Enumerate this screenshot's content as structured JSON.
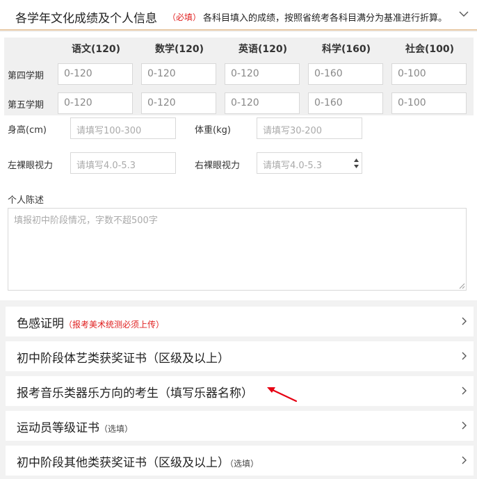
{
  "section": {
    "title": "各学年文化成绩及个人信息",
    "required": "（必填）",
    "note": "各科目填入的成绩，按照省统考各科目满分为基准进行折算。"
  },
  "grades": {
    "subjects": [
      "语文(120)",
      "数学(120)",
      "英语(120)",
      "科学(160)",
      "社会(100)"
    ],
    "terms": [
      {
        "label": "第四学期",
        "placeholders": [
          "0-120",
          "0-120",
          "0-120",
          "0-160",
          "0-100"
        ]
      },
      {
        "label": "第五学期",
        "placeholders": [
          "0-120",
          "0-120",
          "0-120",
          "0-160",
          "0-100"
        ]
      }
    ]
  },
  "personal": {
    "height_label": "身高(cm)",
    "height_placeholder": "请填写100-300",
    "weight_label": "体重(kg)",
    "weight_placeholder": "请填写30-200",
    "left_vision_label": "左裸眼视力",
    "left_vision_placeholder": "请填写4.0-5.3",
    "right_vision_label": "右裸眼视力",
    "right_vision_placeholder": "请填写4.0-5.3",
    "statement_label": "个人陈述",
    "statement_placeholder": "填报初中阶段情况，字数不超500字"
  },
  "rows": [
    {
      "title": "色感证明",
      "note": "（报考美术统测必须上传）",
      "note_color": "red"
    },
    {
      "title": "初中阶段体艺类获奖证书（区级及以上）",
      "note": ""
    },
    {
      "title": "报考音乐类器乐方向的考生（填写乐器名称）",
      "note": ""
    },
    {
      "title": "运动员等级证书",
      "note": "（选填）"
    },
    {
      "title": "初中阶段其他类获奖证书（区级及以上）",
      "note": "（选填）"
    }
  ],
  "colors": {
    "required_red": "#e02020",
    "arrow_red": "#e60012",
    "header_underline": "#e8c9a6"
  },
  "icons": {
    "collapse": "chevron-down-icon",
    "expand": "chevron-right-icon",
    "annotation": "red-arrow-icon"
  }
}
